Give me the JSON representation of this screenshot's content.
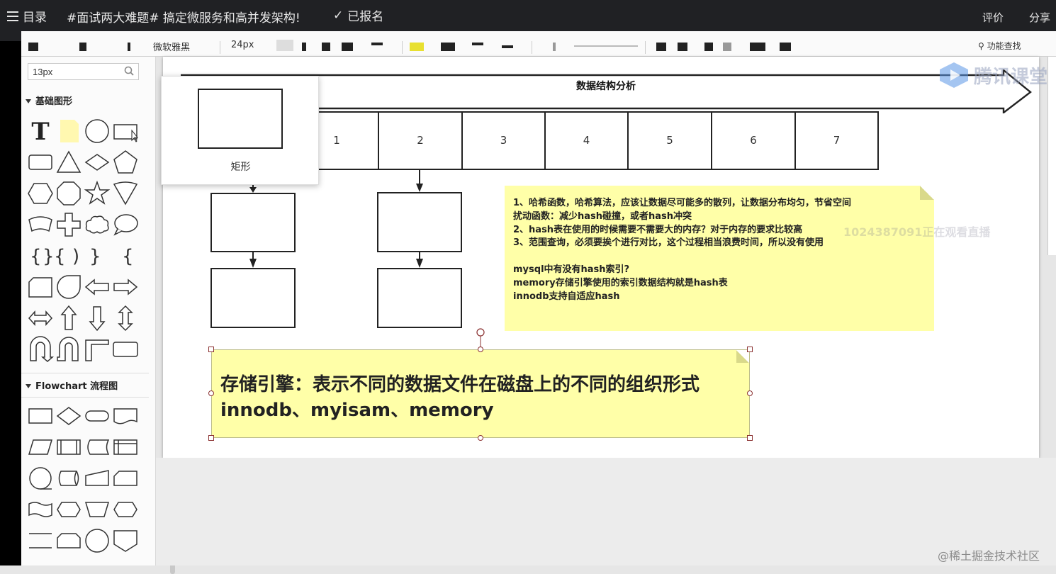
{
  "player": {
    "menu_label": "目录",
    "course_title": "#面试两大难题# 搞定微服务和高并发架构!",
    "signed_label": "已报名",
    "rate_label": "评价",
    "share_label": "分享"
  },
  "toolbar": {
    "font_family": "微软雅黑",
    "font_size": "24px",
    "feature_search": "功能查找"
  },
  "left_panel": {
    "search_value": "13px",
    "section_basic": "基础图形",
    "section_flowchart": "Flowchart 流程图"
  },
  "canvas": {
    "arrow_title": "数据结构分析",
    "numbers": [
      "1",
      "2",
      "3",
      "4",
      "5",
      "6",
      "7"
    ],
    "popup_label": "矩形",
    "note_lines": [
      "1、哈希函数，哈希算法，应该让数据尽可能多的散列，让数据分布均匀，节省空间",
      "扰动函数：减少hash碰撞，或者hash冲突",
      "2、hash表在使用的时候需要不需要大的内存？对于内存的要求比较高",
      "3、范围查询，必须要挨个进行对比，这个过程相当浪费时间，所以没有使用",
      "",
      "mysql中有没有hash索引?",
      "memory存储引擎使用的索引数据结构就是hash表",
      "innodb支持自适应hash"
    ],
    "big_note_line1": "存储引擎：表示不同的数据文件在磁盘上的不同的组织形式",
    "big_note_line2": "innodb、myisam、memory"
  },
  "overlays": {
    "watermark_text": "1024387091正在观看直播",
    "logo_text": "腾讯课堂",
    "footer_text": "@稀土掘金技术社区"
  }
}
